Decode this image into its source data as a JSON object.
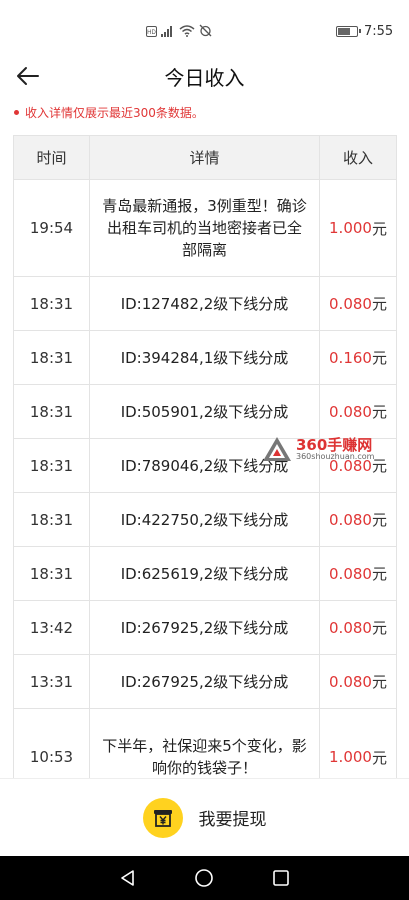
{
  "status_bar": {
    "time": "7:55",
    "battery_level": 0.7,
    "icons": [
      "hd-icon",
      "signal-icon",
      "wifi-icon",
      "no-alarm-icon"
    ]
  },
  "header": {
    "title": "今日收入",
    "back_icon": "back-arrow-icon"
  },
  "notice": {
    "text": "收入详情仅展示最近300条数据。"
  },
  "table": {
    "columns": [
      "时间",
      "详情",
      "收入"
    ],
    "unit": "元",
    "rows": [
      {
        "time": "19:54",
        "detail": "青岛最新通报，3例重型！确诊出租车司机的当地密接者已全部隔离",
        "amount": "1.000"
      },
      {
        "time": "18:31",
        "detail": "ID:127482,2级下线分成",
        "amount": "0.080"
      },
      {
        "time": "18:31",
        "detail": "ID:394284,1级下线分成",
        "amount": "0.160"
      },
      {
        "time": "18:31",
        "detail": "ID:505901,2级下线分成",
        "amount": "0.080"
      },
      {
        "time": "18:31",
        "detail": "ID:789046,2级下线分成",
        "amount": "0.080"
      },
      {
        "time": "18:31",
        "detail": "ID:422750,2级下线分成",
        "amount": "0.080"
      },
      {
        "time": "18:31",
        "detail": "ID:625619,2级下线分成",
        "amount": "0.080"
      },
      {
        "time": "13:42",
        "detail": "ID:267925,2级下线分成",
        "amount": "0.080"
      },
      {
        "time": "13:31",
        "detail": "ID:267925,2级下线分成",
        "amount": "0.080"
      },
      {
        "time": "10:53",
        "detail": "下半年，社保迎来5个变化，影响你的钱袋子！",
        "amount": "1.000"
      }
    ]
  },
  "watermark": {
    "main": "360手赚网",
    "sub": "360shouzhuan.com"
  },
  "withdraw": {
    "label": "我要提现",
    "icon": "yuan-wallet-icon",
    "icon_color": "#ffd21f"
  },
  "colors": {
    "accent_red": "#e03636"
  },
  "nav_bar": {
    "buttons": [
      "back-triangle-icon",
      "home-circle-icon",
      "recents-square-icon"
    ]
  }
}
